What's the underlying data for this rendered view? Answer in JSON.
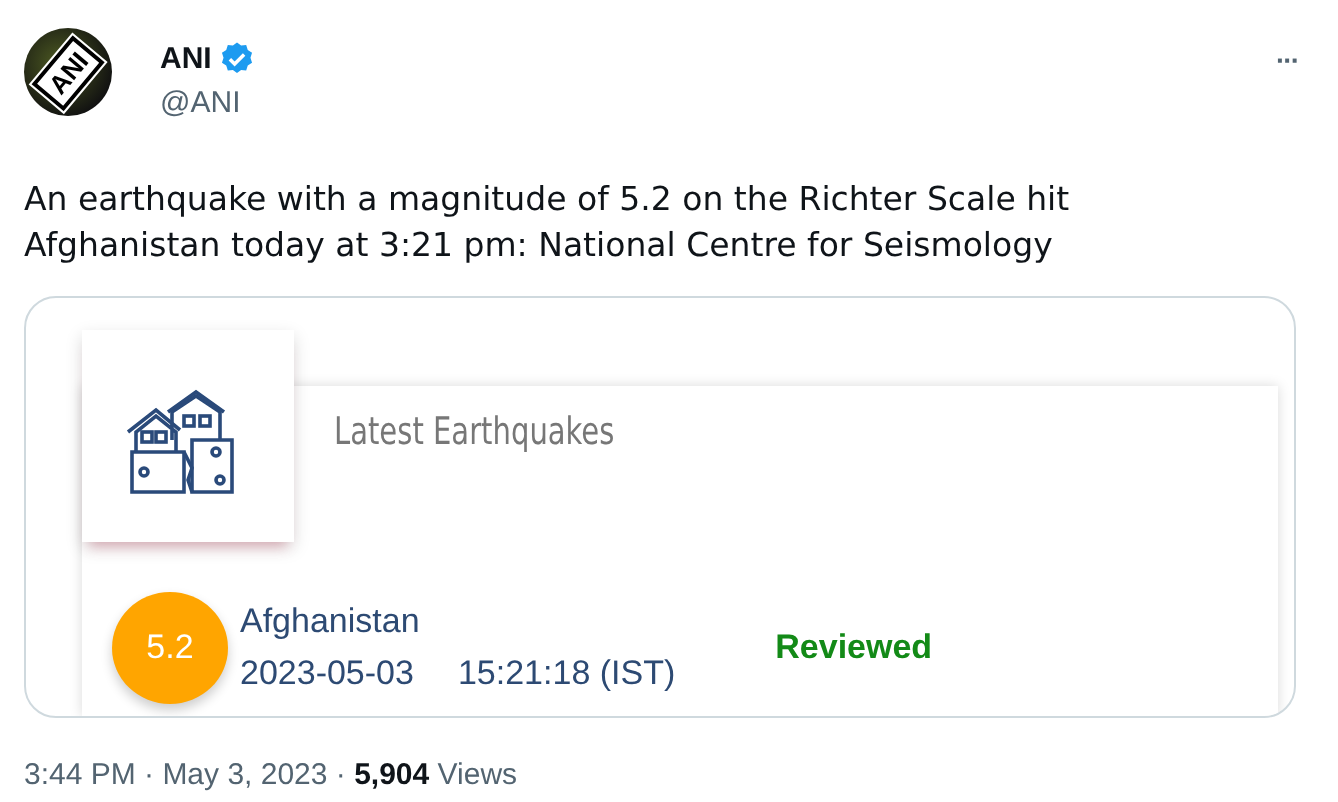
{
  "author": {
    "avatar_logo": "ANI",
    "name": "ANI",
    "verified": true,
    "handle": "@ANI"
  },
  "more_button": "···",
  "text": "An earthquake with a magnitude of 5.2 on the Richter Scale hit Afghanistan today at 3:21 pm: National Centre for Seismology",
  "media": {
    "title": "Latest Earthquakes",
    "quake": {
      "magnitude": "5.2",
      "region": "Afghanistan",
      "date": "2023-05-03",
      "time": "15:21:18 (IST)",
      "status": "Reviewed"
    }
  },
  "footer": "3:44 PM · May 3, 2023 · **5,904** Views"
}
